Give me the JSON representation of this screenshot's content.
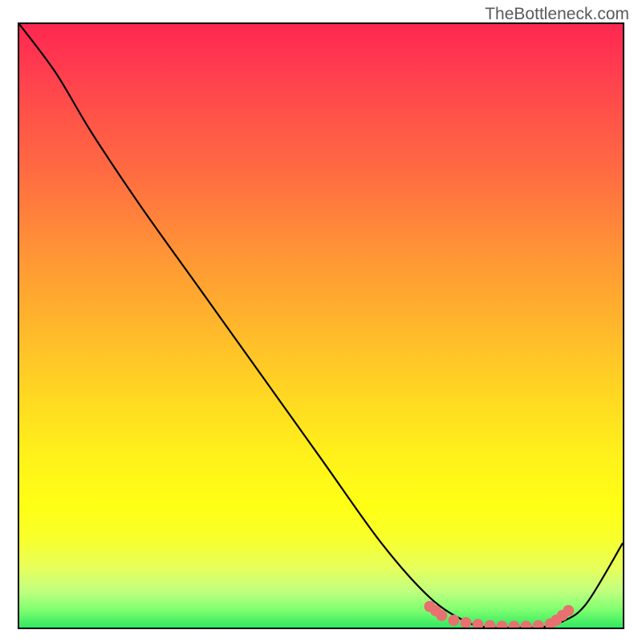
{
  "watermark": "TheBottleneck.com",
  "chart_data": {
    "type": "line",
    "title": "",
    "xlabel": "",
    "ylabel": "",
    "xlim": [
      0,
      100
    ],
    "ylim": [
      0,
      100
    ],
    "series": [
      {
        "name": "curve",
        "x": [
          0,
          6,
          12,
          20,
          30,
          40,
          50,
          60,
          68,
          74,
          78,
          82,
          86,
          90,
          94,
          100
        ],
        "y": [
          100,
          92,
          82,
          70,
          56,
          42,
          28,
          14,
          5,
          1,
          0,
          0,
          0,
          1,
          4,
          14
        ],
        "color": "#000000"
      },
      {
        "name": "markers",
        "x": [
          68,
          69,
          70,
          72,
          74,
          76,
          78,
          80,
          82,
          84,
          86,
          88,
          89,
          90,
          91
        ],
        "y": [
          3.5,
          2.8,
          2.0,
          1.2,
          0.8,
          0.5,
          0.3,
          0.2,
          0.2,
          0.2,
          0.3,
          0.6,
          1.2,
          2.0,
          2.8
        ],
        "color": "#e87070"
      }
    ],
    "background_gradient": {
      "stops": [
        {
          "offset": 0,
          "color": "#ff2750"
        },
        {
          "offset": 50,
          "color": "#ffb12d"
        },
        {
          "offset": 80,
          "color": "#ffff15"
        },
        {
          "offset": 100,
          "color": "#30e860"
        }
      ]
    }
  }
}
